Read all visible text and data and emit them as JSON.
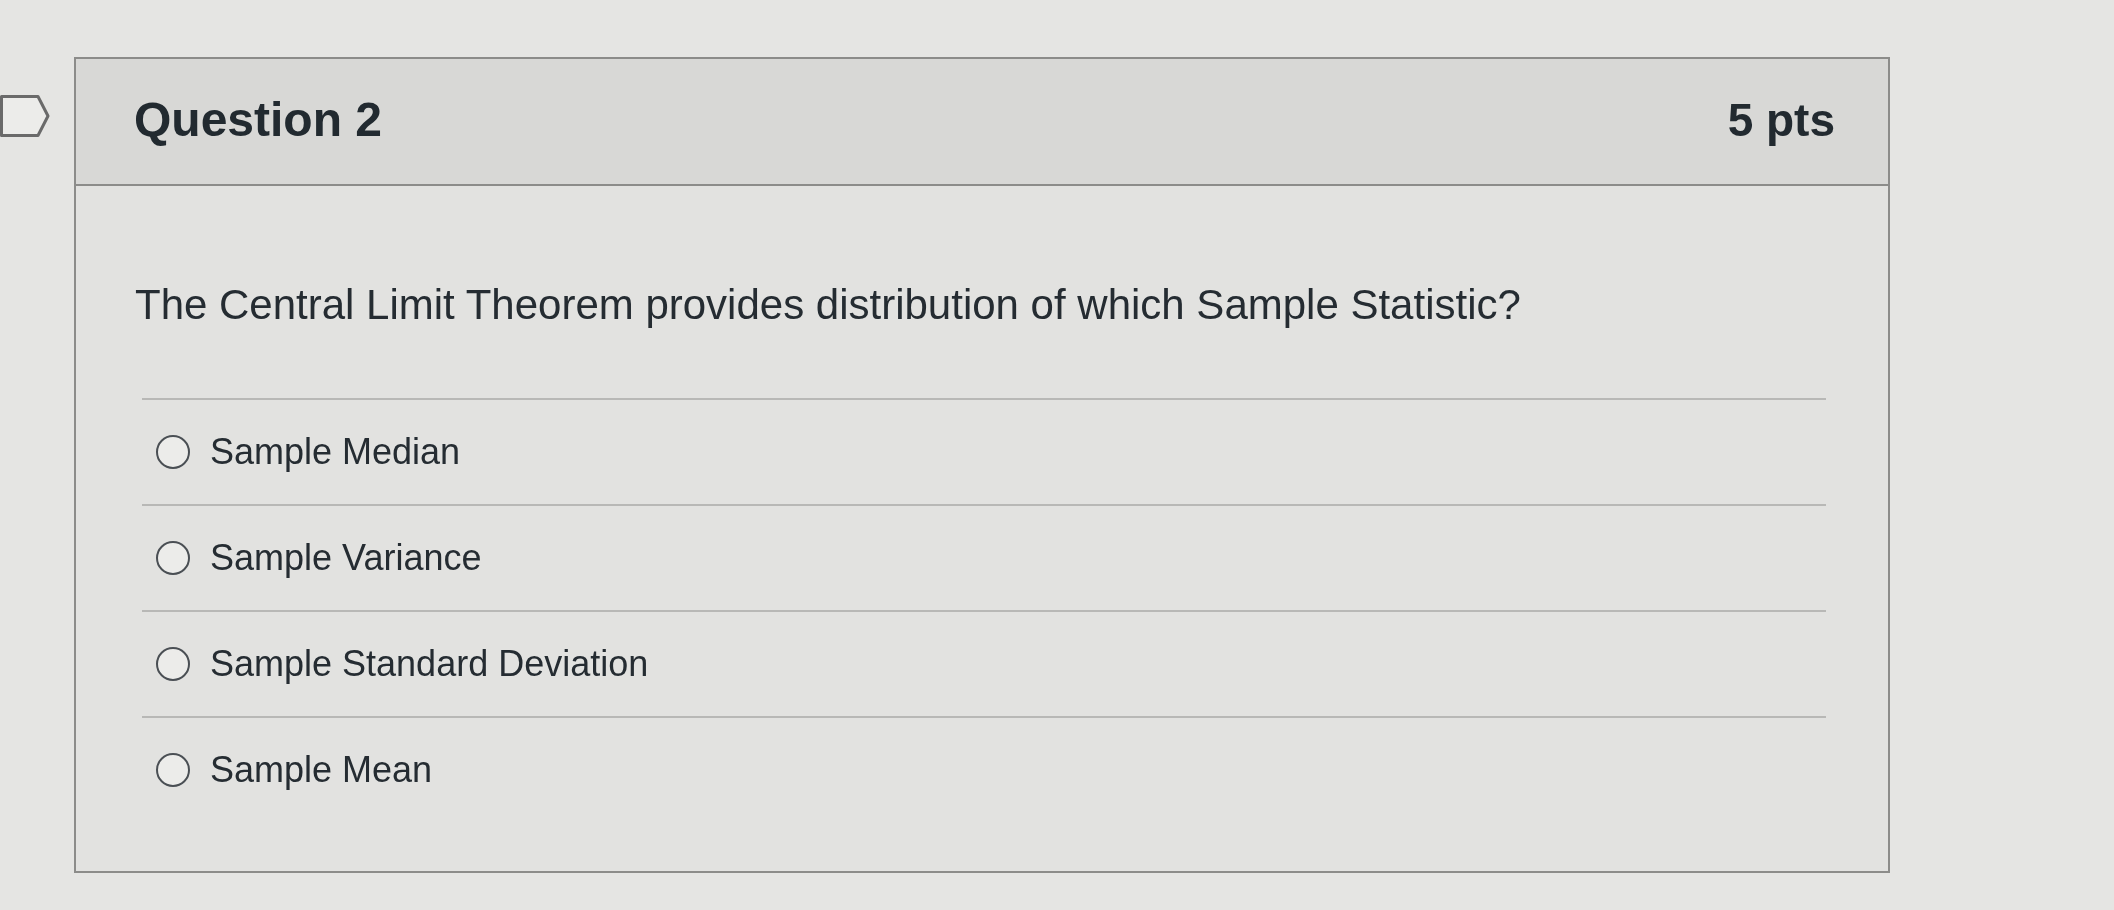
{
  "question": {
    "title": "Question 2",
    "points": "5 pts",
    "flagged": false
  },
  "prompt": "The Central Limit Theorem provides distribution of which Sample Statistic?",
  "options": [
    {
      "label": "Sample Median",
      "selected": false
    },
    {
      "label": "Sample Variance",
      "selected": false
    },
    {
      "label": "Sample Standard Deviation",
      "selected": false
    },
    {
      "label": "Sample Mean",
      "selected": false
    }
  ]
}
